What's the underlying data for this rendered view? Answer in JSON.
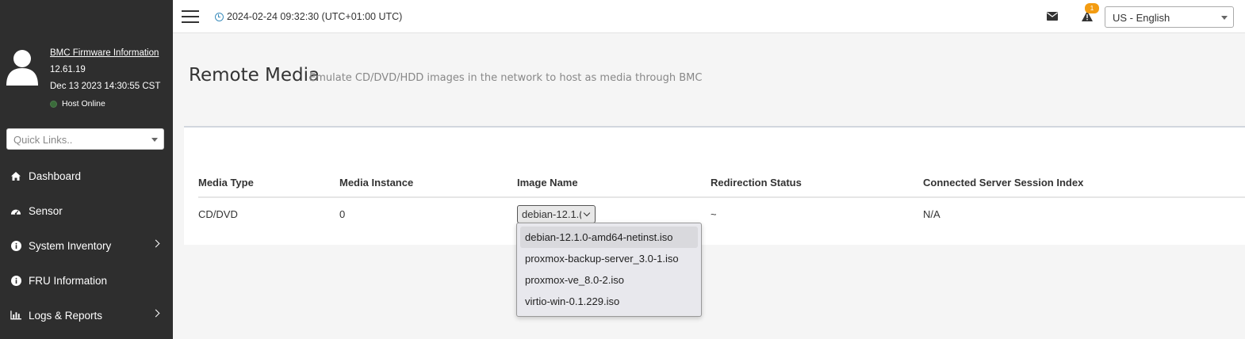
{
  "sidebar": {
    "firmware_link": "BMC Firmware Information",
    "firmware_version": "12.61.19",
    "firmware_date": "Dec 13 2023 14:30:55 CST",
    "host_status": "Host Online",
    "host_status_color": "#3a6b3a",
    "quick_links_placeholder": "Quick Links..",
    "items": [
      {
        "label": "Dashboard",
        "icon": "home-icon",
        "has_children": false
      },
      {
        "label": "Sensor",
        "icon": "dashboard-gauge-icon",
        "has_children": false
      },
      {
        "label": "System Inventory",
        "icon": "info-circle-icon",
        "has_children": true
      },
      {
        "label": "FRU Information",
        "icon": "info-circle-icon",
        "has_children": false
      },
      {
        "label": "Logs & Reports",
        "icon": "bar-chart-icon",
        "has_children": true
      }
    ]
  },
  "header": {
    "datetime": "2024-02-24 09:32:30 (UTC+01:00 UTC)",
    "alert_count": "1",
    "language": "US - English"
  },
  "page": {
    "title": "Remote Media",
    "subtitle": "Emulate CD/DVD/HDD images in the network to host as media through BMC"
  },
  "table": {
    "columns": [
      "Media Type",
      "Media Instance",
      "Image Name",
      "Redirection Status",
      "Connected Server Session Index"
    ],
    "rows": [
      {
        "media_type": "CD/DVD",
        "media_instance": "0",
        "image_name": "debian-12.1.0-amd64-netinst.iso",
        "image_name_visible": "debian-12.1.(",
        "redirection_status": "~",
        "session_index": "N/A"
      }
    ]
  },
  "image_dropdown": {
    "options": [
      "debian-12.1.0-amd64-netinst.iso",
      "proxmox-backup-server_3.0-1.iso",
      "proxmox-ve_8.0-2.iso",
      "virtio-win-0.1.229.iso"
    ],
    "selected_index": 0
  },
  "colors": {
    "sidebar_bg": "#2e2e2e",
    "accent": "#3c8dbc",
    "badge": "#f39c12"
  }
}
